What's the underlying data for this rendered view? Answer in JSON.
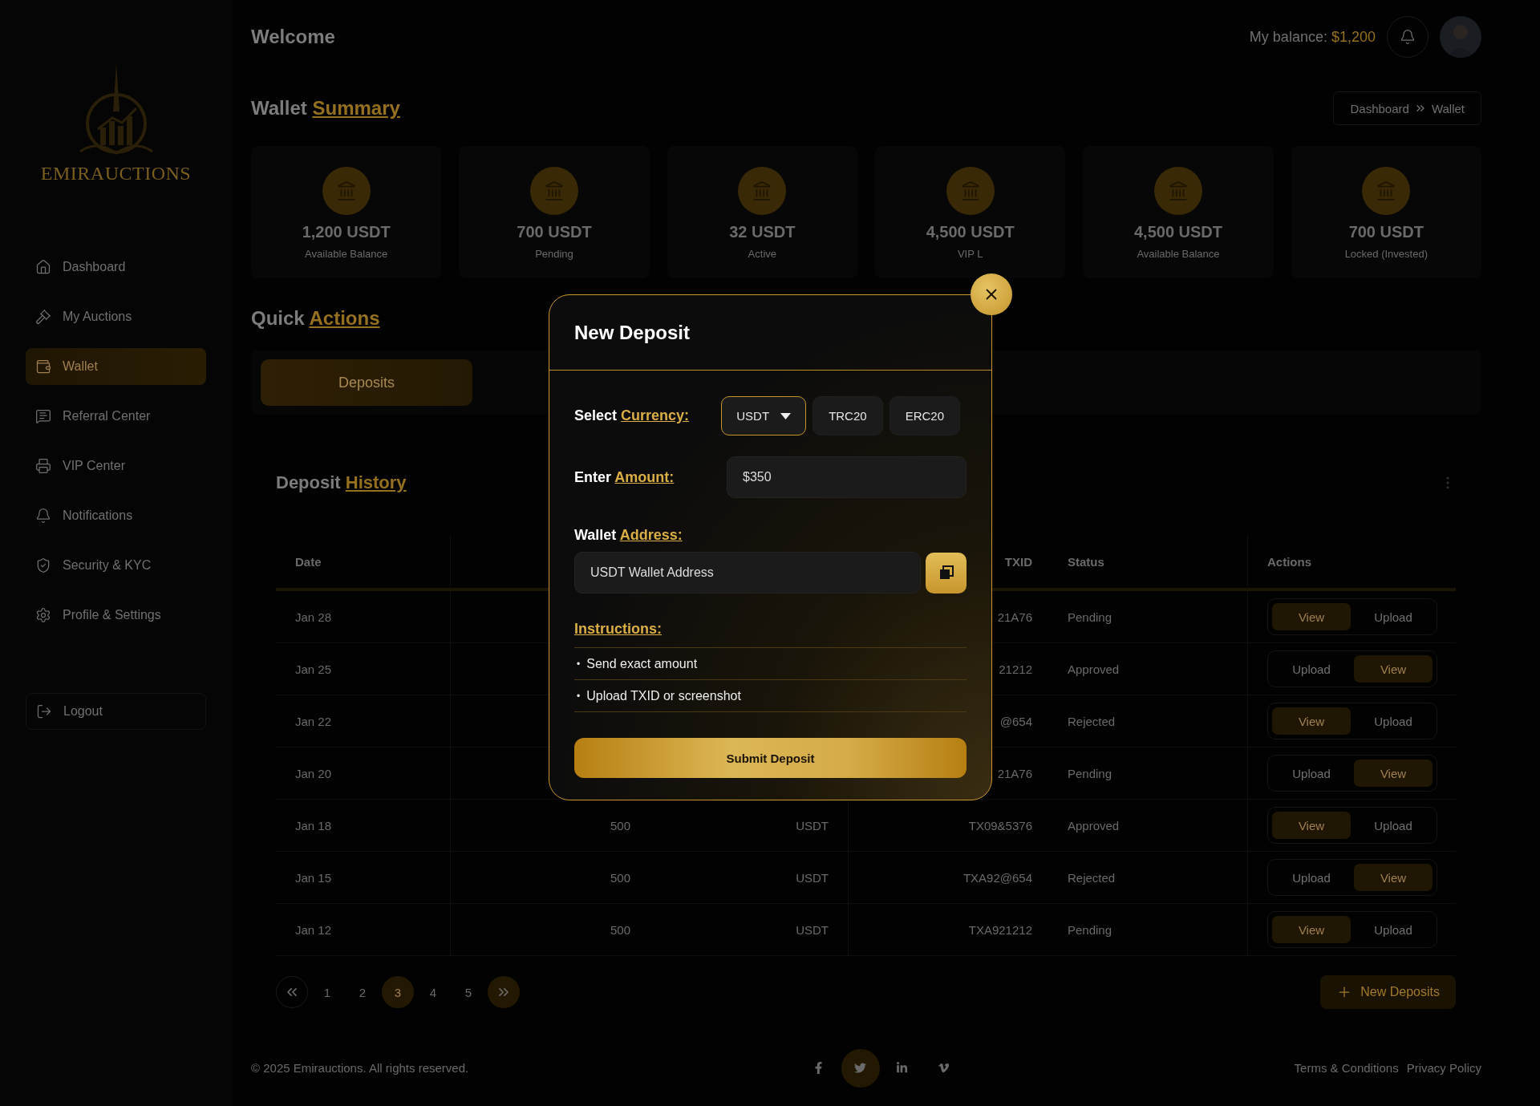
{
  "sidebar": {
    "logo": "EMIRAUCTIONS",
    "items": [
      {
        "label": "Dashboard",
        "selected": false
      },
      {
        "label": "My Auctions",
        "selected": false
      },
      {
        "label": "Wallet",
        "selected": true
      },
      {
        "label": "Referral Center",
        "selected": false
      },
      {
        "label": "VIP Center",
        "selected": false
      },
      {
        "label": "Notifications",
        "selected": false
      },
      {
        "label": "Security & KYC",
        "selected": false
      },
      {
        "label": "Profile & Settings",
        "selected": false
      }
    ],
    "logout": "Logout"
  },
  "header": {
    "title": "Welcome",
    "balance_label": "My balance:",
    "balance_value": "$1,200"
  },
  "wallet_summary": {
    "title": "Wallet",
    "title_accent": "Summary",
    "breadcrumb": [
      "Dashboard",
      "Wallet"
    ],
    "cards": [
      {
        "amount": "1,200 USDT",
        "label": "Available Balance"
      },
      {
        "amount": "700 USDT",
        "label": "Pending"
      },
      {
        "amount": "32 USDT",
        "label": "Active"
      },
      {
        "amount": "4,500 USDT",
        "label": "VIP L"
      },
      {
        "amount": "4,500 USDT",
        "label": "Available Balance"
      },
      {
        "amount": "700 USDT",
        "label": "Locked (Invested)"
      }
    ]
  },
  "quick_actions": {
    "title": "Quick",
    "title_accent": "Actions",
    "tabs": [
      {
        "label": "Deposits",
        "selected": true
      }
    ]
  },
  "deposit_history": {
    "title": "Deposit",
    "title_accent": "History",
    "columns": [
      {
        "label": "Date"
      },
      {},
      {},
      {
        "label": "TXID"
      },
      {
        "label": "Status"
      },
      {
        "label": "Actions"
      }
    ],
    "rows": [
      {
        "date": "Jan 28",
        "txid": "21A76",
        "status": "Pending",
        "actions": [
          {
            "label": "View",
            "selected": true
          },
          {
            "label": "Upload",
            "selected": false
          }
        ]
      },
      {
        "date": "Jan 25",
        "txid": "21212",
        "status": "Approved",
        "actions": [
          {
            "label": "Upload",
            "selected": false
          },
          {
            "label": "View",
            "selected": true
          }
        ]
      },
      {
        "date": "Jan 22",
        "txid": "@654",
        "status": "Rejected",
        "actions": [
          {
            "label": "View",
            "selected": true
          },
          {
            "label": "Upload",
            "selected": false
          }
        ]
      },
      {
        "date": "Jan 20",
        "txid": "21A76",
        "status": "Pending",
        "actions": [
          {
            "label": "Upload",
            "selected": false
          },
          {
            "label": "View",
            "selected": true
          }
        ]
      },
      {
        "date": "Jan 18",
        "column_2": "500",
        "column_3": "USDT",
        "txid": "TX09&5376",
        "status": "Approved",
        "actions": [
          {
            "label": "View",
            "selected": true
          },
          {
            "label": "Upload",
            "selected": false
          }
        ]
      },
      {
        "date": "Jan 15",
        "column_2": "500",
        "column_3": "USDT",
        "txid": "TXA92@654",
        "status": "Rejected",
        "actions": [
          {
            "label": "Upload",
            "selected": false
          },
          {
            "label": "View",
            "selected": true
          }
        ]
      },
      {
        "date": "Jan 12",
        "column_2": "500",
        "column_3": "USDT",
        "txid": "TXA921212",
        "status": "Pending",
        "actions": [
          {
            "label": "View",
            "selected": true
          },
          {
            "label": "Upload",
            "selected": false
          }
        ]
      }
    ],
    "pagination": [
      {
        "label": "1",
        "selected": false
      },
      {
        "label": "2",
        "selected": false
      },
      {
        "label": "3",
        "selected": true
      },
      {
        "label": "4",
        "selected": false
      },
      {
        "label": "5",
        "selected": false
      }
    ],
    "new_button": "New Deposits"
  },
  "footer": {
    "copyright": "© 2025 Emirauctions. All rights reserved.",
    "links": [
      "Terms & Conditions",
      "Privacy Policy"
    ]
  },
  "modal": {
    "title": "New Deposit",
    "currency": {
      "label": "Select",
      "label_accent": "Currency:",
      "options": [
        {
          "label": "USDT",
          "kind": "dropdown",
          "selected": true
        },
        {
          "label": "TRC20",
          "kind": "chip",
          "selected": false
        },
        {
          "label": "ERC20",
          "kind": "chip",
          "selected": false
        }
      ]
    },
    "amount": {
      "label": "Enter",
      "label_accent": "Amount:",
      "value": "$350"
    },
    "address": {
      "label": "Wallet",
      "label_accent": "Address:",
      "value": "USDT Wallet Address"
    },
    "instructions": {
      "title": "Instructions:",
      "bullet": "•",
      "items": [
        "Send exact amount",
        "Upload TXID or screenshot"
      ]
    },
    "submit": "Submit Deposit"
  }
}
